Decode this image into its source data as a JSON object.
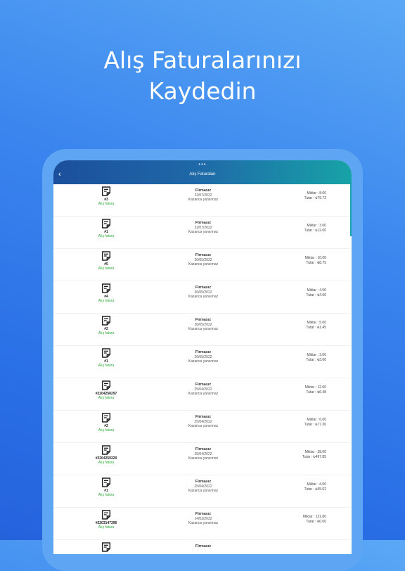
{
  "headline": {
    "line1": "Alış Faturalarınızı",
    "line2": "Kaydedin"
  },
  "appbar": {
    "title": "Alış Faturaları",
    "back_glyph": "‹",
    "dots": "•••"
  },
  "rows": [
    {
      "num": "#3",
      "type": "Alış fatura",
      "firm": "Firmasız",
      "date": "22/07/2022",
      "gain": "Kazanca yansımaz",
      "qty": "Miktar : 8.00",
      "total": "Tutar : ₺79.72"
    },
    {
      "num": "#1",
      "type": "Alış fatura",
      "firm": "Firmasız",
      "date": "22/07/2022",
      "gain": "Kazanca yansımaz",
      "qty": "Miktar : 3.00",
      "total": "Tutar : ₺12.00"
    },
    {
      "num": "#5",
      "type": "Alış fatura",
      "firm": "Firmasız",
      "date": "26/05/2022",
      "gain": "Kazanca yansımaz",
      "qty": "Miktar : 10.00",
      "total": "Tutar : ₺8.75"
    },
    {
      "num": "#4",
      "type": "Alış fatura",
      "firm": "Firmasız",
      "date": "26/05/2022",
      "gain": "Kazanca yansımaz",
      "qty": "Miktar : 4.50",
      "total": "Tutar : ₺4.60"
    },
    {
      "num": "#2",
      "type": "Alış fatura",
      "firm": "Firmasız",
      "date": "26/05/2022",
      "gain": "Kazanca yansımaz",
      "qty": "Miktar : 5.00",
      "total": "Tutar : ₺1.45"
    },
    {
      "num": "#1",
      "type": "Alış fatura",
      "firm": "Firmasız",
      "date": "26/05/2022",
      "gain": "Kazanca yansımaz",
      "qty": "Miktar : 3.00",
      "total": "Tutar : ₺3.60"
    },
    {
      "num": "#2204258297",
      "type": "Alış fatura",
      "firm": "Firmasız",
      "date": "25/04/2022",
      "gain": "Kazanca yansımaz",
      "qty": "Miktar : 12.00",
      "total": "Tutar : ₺6.48"
    },
    {
      "num": "#2",
      "type": "Alış fatura",
      "firm": "Firmasız",
      "date": "25/04/2022",
      "gain": "Kazanca yansımaz",
      "qty": "Miktar : 6.00",
      "total": "Tutar : ₺77.36"
    },
    {
      "num": "#2204259220",
      "type": "Alış fatura",
      "firm": "Firmasız",
      "date": "25/04/2022",
      "gain": "Kazanca yansımaz",
      "qty": "Miktar : 28.00",
      "total": "Tutar : ₺497.85"
    },
    {
      "num": "#1",
      "type": "Alış fatura",
      "firm": "Firmasız",
      "date": "25/04/2022",
      "gain": "Kazanca yansımaz",
      "qty": "Miktar : 4.00",
      "total": "Tutar : ₺55.02"
    },
    {
      "num": "#2203147396",
      "type": "Alış fatura",
      "firm": "Firmasız",
      "date": "14/03/2022",
      "gain": "Kazanca yansımaz",
      "qty": "Miktar : 121.80",
      "total": "Tutar : ₺0.00"
    },
    {
      "num": "",
      "type": "",
      "firm": "Firmasız",
      "date": "",
      "gain": "",
      "qty": "",
      "total": ""
    }
  ],
  "icons": {
    "row": "receipt-document-icon",
    "back": "chevron-left-icon"
  },
  "colors": {
    "accent_green": "#2fae38",
    "appbar_start": "#1b4f9c",
    "appbar_end": "#17a3a7",
    "background": "#3a85ee"
  }
}
